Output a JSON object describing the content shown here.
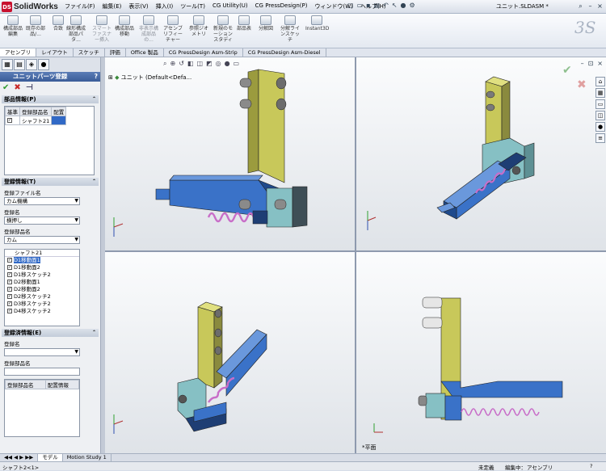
{
  "app": {
    "logo_text": "SolidWorks",
    "doc_title": "ユニット.SLDASM *"
  },
  "menu": [
    "ファイル(F)",
    "編集(E)",
    "表示(V)",
    "挿入(I)",
    "ツール(T)",
    "CG Utility(U)",
    "CG PressDesign(P)",
    "ウィンドウ(W)",
    "ヘルプ(H)"
  ],
  "commands": [
    {
      "label": "構成部品編集",
      "dim": false
    },
    {
      "label": "既存の部品/...",
      "dim": false
    },
    {
      "label": "合致",
      "dim": false
    },
    {
      "label": "線形構成部品パタ...",
      "dim": false
    },
    {
      "label": "スマートファスナー挿入",
      "dim": true
    },
    {
      "label": "構成部品移動",
      "dim": false
    },
    {
      "label": "非表示構成部品の...",
      "dim": true
    },
    {
      "label": "アセンブリフィーチャー",
      "dim": false
    },
    {
      "label": "参照ジオメトリ",
      "dim": false
    },
    {
      "label": "新規のモーションスタディ",
      "dim": false
    },
    {
      "label": "部品表",
      "dim": false
    },
    {
      "label": "分解図",
      "dim": false
    },
    {
      "label": "分解ラインスケッチ",
      "dim": false
    },
    {
      "label": "Instant3D",
      "dim": false
    }
  ],
  "tabs": [
    "アセンブリ",
    "レイアウト",
    "スケッチ",
    "評価",
    "Office 製品",
    "CG PressDesign Asm-Strip",
    "CG PressDesign Asm-Diesel"
  ],
  "panel": {
    "title": "ユニットパーツ登録",
    "parts_group": "部品情報(P)",
    "parts_table": {
      "headers": [
        "基準",
        "登録部品名",
        "配置"
      ],
      "rows": [
        {
          "name": "シャフト21",
          "checked": true
        }
      ]
    },
    "reg_group": "登録情報(T)",
    "file_label": "登録ファイル名",
    "file_value": "カム機構",
    "reg_label": "登録名",
    "reg_value": "横押し",
    "part_label": "登録部品名",
    "part_value": "カム",
    "list_header": "シャフト21",
    "items": [
      {
        "label": "D1移動面1",
        "checked": true,
        "selected": true
      },
      {
        "label": "D1移動面2",
        "checked": true,
        "selected": false
      },
      {
        "label": "D1移スケッチ2",
        "checked": true,
        "selected": false
      },
      {
        "label": "D2移動面1",
        "checked": true,
        "selected": false
      },
      {
        "label": "D2移動面2",
        "checked": true,
        "selected": false
      },
      {
        "label": "D2移スケッチ2",
        "checked": true,
        "selected": false
      },
      {
        "label": "D3移スケッチ2",
        "checked": true,
        "selected": false
      },
      {
        "label": "D4移スケッチ2",
        "checked": true,
        "selected": false
      }
    ],
    "done_group": "登録済情報(E)",
    "done_reg_label": "登録名",
    "done_part_label": "登録部品名",
    "done_table_headers": [
      "登録部品名",
      "配置情報"
    ]
  },
  "viewport": {
    "tree_label": "ユニット (Default<Defa...",
    "plane_label": "*平面"
  },
  "bottom_tabs": [
    "モデル",
    "Motion Study 1"
  ],
  "status": {
    "left": "シャフト2<1>",
    "undefined": "未定義",
    "editing": "編集中：",
    "mode": "アセンブリ"
  },
  "colors": {
    "yellow": "#c8c85a",
    "blue": "#3a72c8",
    "teal": "#86c0c4",
    "spring": "#c86ec8",
    "accent": "#3a5c98"
  }
}
